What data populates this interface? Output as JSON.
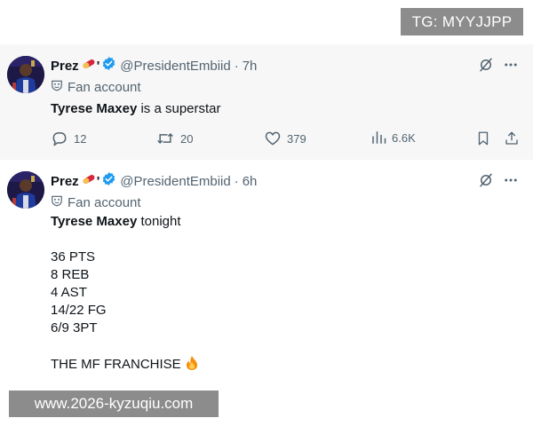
{
  "watermarks": {
    "top": "TG: MYYJJPP",
    "bottom": "www.2026-kyzuqiu.com"
  },
  "tweets": [
    {
      "author": {
        "name": "Prez",
        "handle": "@PresidentEmbiid",
        "verified": true,
        "label": "Fan account"
      },
      "time": "7h",
      "text": {
        "bold": "Tyrese Maxey",
        "rest": " is a superstar"
      },
      "metrics": {
        "replies": "12",
        "retweets": "20",
        "likes": "379",
        "views": "6.6K"
      }
    },
    {
      "author": {
        "name": "Prez",
        "handle": "@PresidentEmbiid",
        "verified": true,
        "label": "Fan account"
      },
      "time": "6h",
      "text": {
        "bold": "Tyrese Maxey",
        "rest": " tonight",
        "stats": [
          "36 PTS",
          "8 REB",
          "4 AST",
          "14/22 FG",
          "6/9 3PT"
        ],
        "closing": "THE MF FRANCHISE"
      }
    }
  ],
  "icons": {
    "verified": "verified-badge-icon",
    "fan": "mask-icon",
    "pill": "pill-emoji-icon",
    "fire": "fire-emoji-icon",
    "grok": "grok-icon",
    "more": "more-icon"
  },
  "colors": {
    "text": "#0f1419",
    "muted": "#536471",
    "verified": "#1d9bf0",
    "watermark": "#8c8c8c"
  }
}
